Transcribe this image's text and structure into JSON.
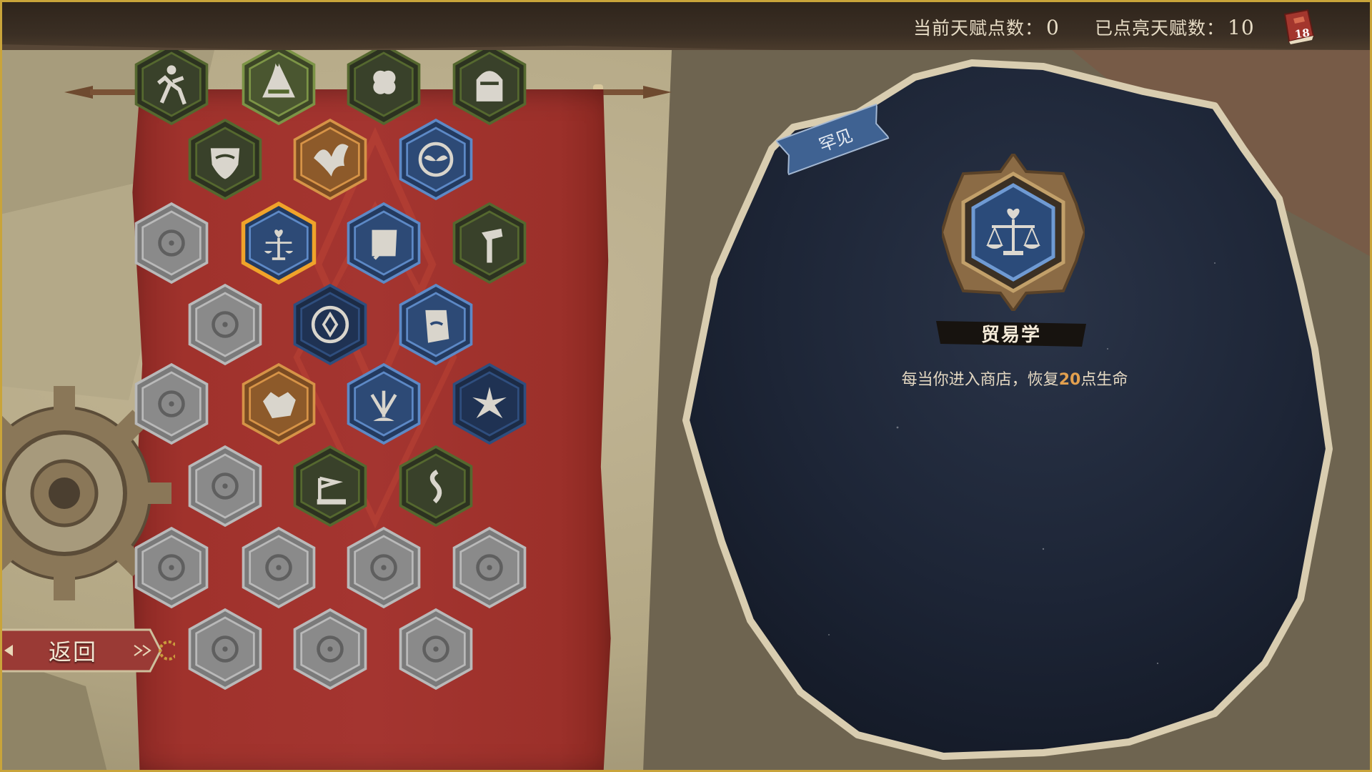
{
  "header": {
    "current_points_label": "当前天赋点数：",
    "current_points": "0",
    "lit_talents_label": "已点亮天赋数：",
    "lit_talents": "10",
    "book_count": "18"
  },
  "back_button": {
    "label": "返回"
  },
  "selected_talent": {
    "rarity": "罕见",
    "name": "贸易学",
    "description_before": "每当你进入商店，恢复",
    "description_value": "20",
    "description_after": "点生命",
    "icon": "scales-heart-icon"
  },
  "colors": {
    "highlight": "#e2a04f",
    "selected_border": "#f0a32a",
    "common_green": "#5e7a33",
    "rare_blue": "#4f78b5",
    "epic_orange": "#d38a3c",
    "locked_grey": "#8e8e8e",
    "banner_red": "#a43530"
  },
  "talents": [
    {
      "icon": "runner-icon",
      "rarity": "common",
      "state": "unlocked"
    },
    {
      "icon": "helmet-crest-icon",
      "rarity": "uncommon",
      "state": "unlocked"
    },
    {
      "icon": "clover-icon",
      "rarity": "common",
      "state": "unlocked"
    },
    {
      "icon": "knight-helmet-icon",
      "rarity": "common",
      "state": "unlocked"
    },
    {
      "icon": "shield-icon",
      "rarity": "common",
      "state": "unlocked"
    },
    {
      "icon": "phoenix-icon",
      "rarity": "epic",
      "state": "unlocked"
    },
    {
      "icon": "sprout-icon",
      "rarity": "rare",
      "state": "unlocked"
    },
    {
      "icon": "lock-icon",
      "rarity": "none",
      "state": "locked"
    },
    {
      "icon": "scales-heart-icon",
      "rarity": "rare",
      "state": "selected"
    },
    {
      "icon": "scroll-quill-icon",
      "rarity": "rare",
      "state": "unlocked"
    },
    {
      "icon": "sword-fist-icon",
      "rarity": "common",
      "state": "unlocked"
    },
    {
      "icon": "lock-icon",
      "rarity": "none",
      "state": "locked"
    },
    {
      "icon": "rune-circle-icon",
      "rarity": "dark",
      "state": "unlocked"
    },
    {
      "icon": "mask-scroll-icon",
      "rarity": "rare",
      "state": "unlocked"
    },
    {
      "icon": "lock-icon",
      "rarity": "none",
      "state": "locked"
    },
    {
      "icon": "beast-icon",
      "rarity": "epic",
      "state": "unlocked"
    },
    {
      "icon": "arrows-icon",
      "rarity": "rare",
      "state": "unlocked"
    },
    {
      "icon": "starburst-icon",
      "rarity": "dark",
      "state": "unlocked"
    },
    {
      "icon": "lock-icon",
      "rarity": "none",
      "state": "locked"
    },
    {
      "icon": "flag-ship-icon",
      "rarity": "common",
      "state": "unlocked"
    },
    {
      "icon": "serpent-icon",
      "rarity": "common",
      "state": "unlocked"
    },
    {
      "icon": "lock-icon",
      "rarity": "none",
      "state": "locked"
    },
    {
      "icon": "lock-icon",
      "rarity": "none",
      "state": "locked"
    },
    {
      "icon": "lock-icon",
      "rarity": "none",
      "state": "locked"
    },
    {
      "icon": "lock-icon",
      "rarity": "none",
      "state": "locked"
    },
    {
      "icon": "lock-icon",
      "rarity": "none",
      "state": "locked"
    },
    {
      "icon": "lock-icon",
      "rarity": "none",
      "state": "locked"
    },
    {
      "icon": "lock-icon",
      "rarity": "none",
      "state": "locked"
    }
  ]
}
